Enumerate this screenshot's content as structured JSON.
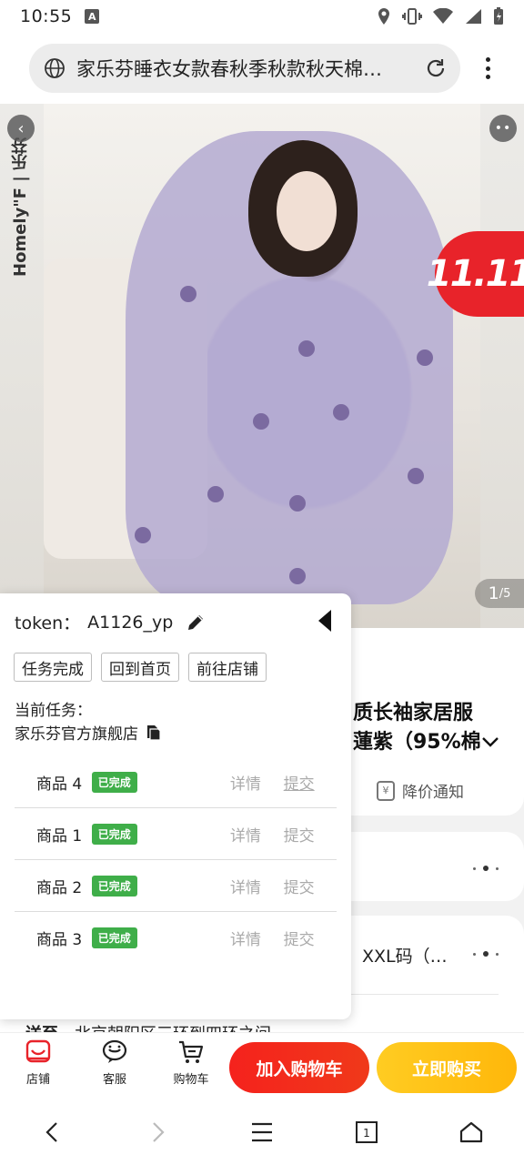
{
  "status_bar": {
    "time": "10:55",
    "notification_icon": "A"
  },
  "browser": {
    "url_title": "家乐芬睡衣女款春秋季秋款秋天棉…"
  },
  "product": {
    "brand_text": "Homely\"F | 乐芬",
    "promo_badge": "11.11",
    "pager_current": "1",
    "pager_total": "/5",
    "title_line1": "质长袖家居服",
    "title_line2": "蓮紫（95%棉",
    "price_notify": "降价通知",
    "sku_text": "XXL码（…",
    "ship_label": "送至",
    "ship_address": "北京朝阳区三环到四环之间"
  },
  "bottom_bar": {
    "store": "店铺",
    "service": "客服",
    "cart": "购物车",
    "add_to_cart": "加入购物车",
    "buy_now": "立即购买"
  },
  "panel": {
    "token_label": "token：",
    "token_value": "A1126_yp",
    "btn_task_done": "任务完成",
    "btn_home": "回到首页",
    "btn_store": "前往店铺",
    "task_label": "当前任务：",
    "task_value": "家乐芬官方旗舰店",
    "items": [
      {
        "name": "商品 4",
        "status": "已完成",
        "detail": "详情",
        "submit": "提交"
      },
      {
        "name": "商品 1",
        "status": "已完成",
        "detail": "详情",
        "submit": "提交"
      },
      {
        "name": "商品 2",
        "status": "已完成",
        "detail": "详情",
        "submit": "提交"
      },
      {
        "name": "商品 3",
        "status": "已完成",
        "detail": "详情",
        "submit": "提交"
      }
    ]
  },
  "nav": {
    "tabs_count": "1"
  },
  "colors": {
    "accent_red": "#f5221d",
    "accent_yellow": "#ffb70a",
    "badge_green": "#3fae49"
  }
}
